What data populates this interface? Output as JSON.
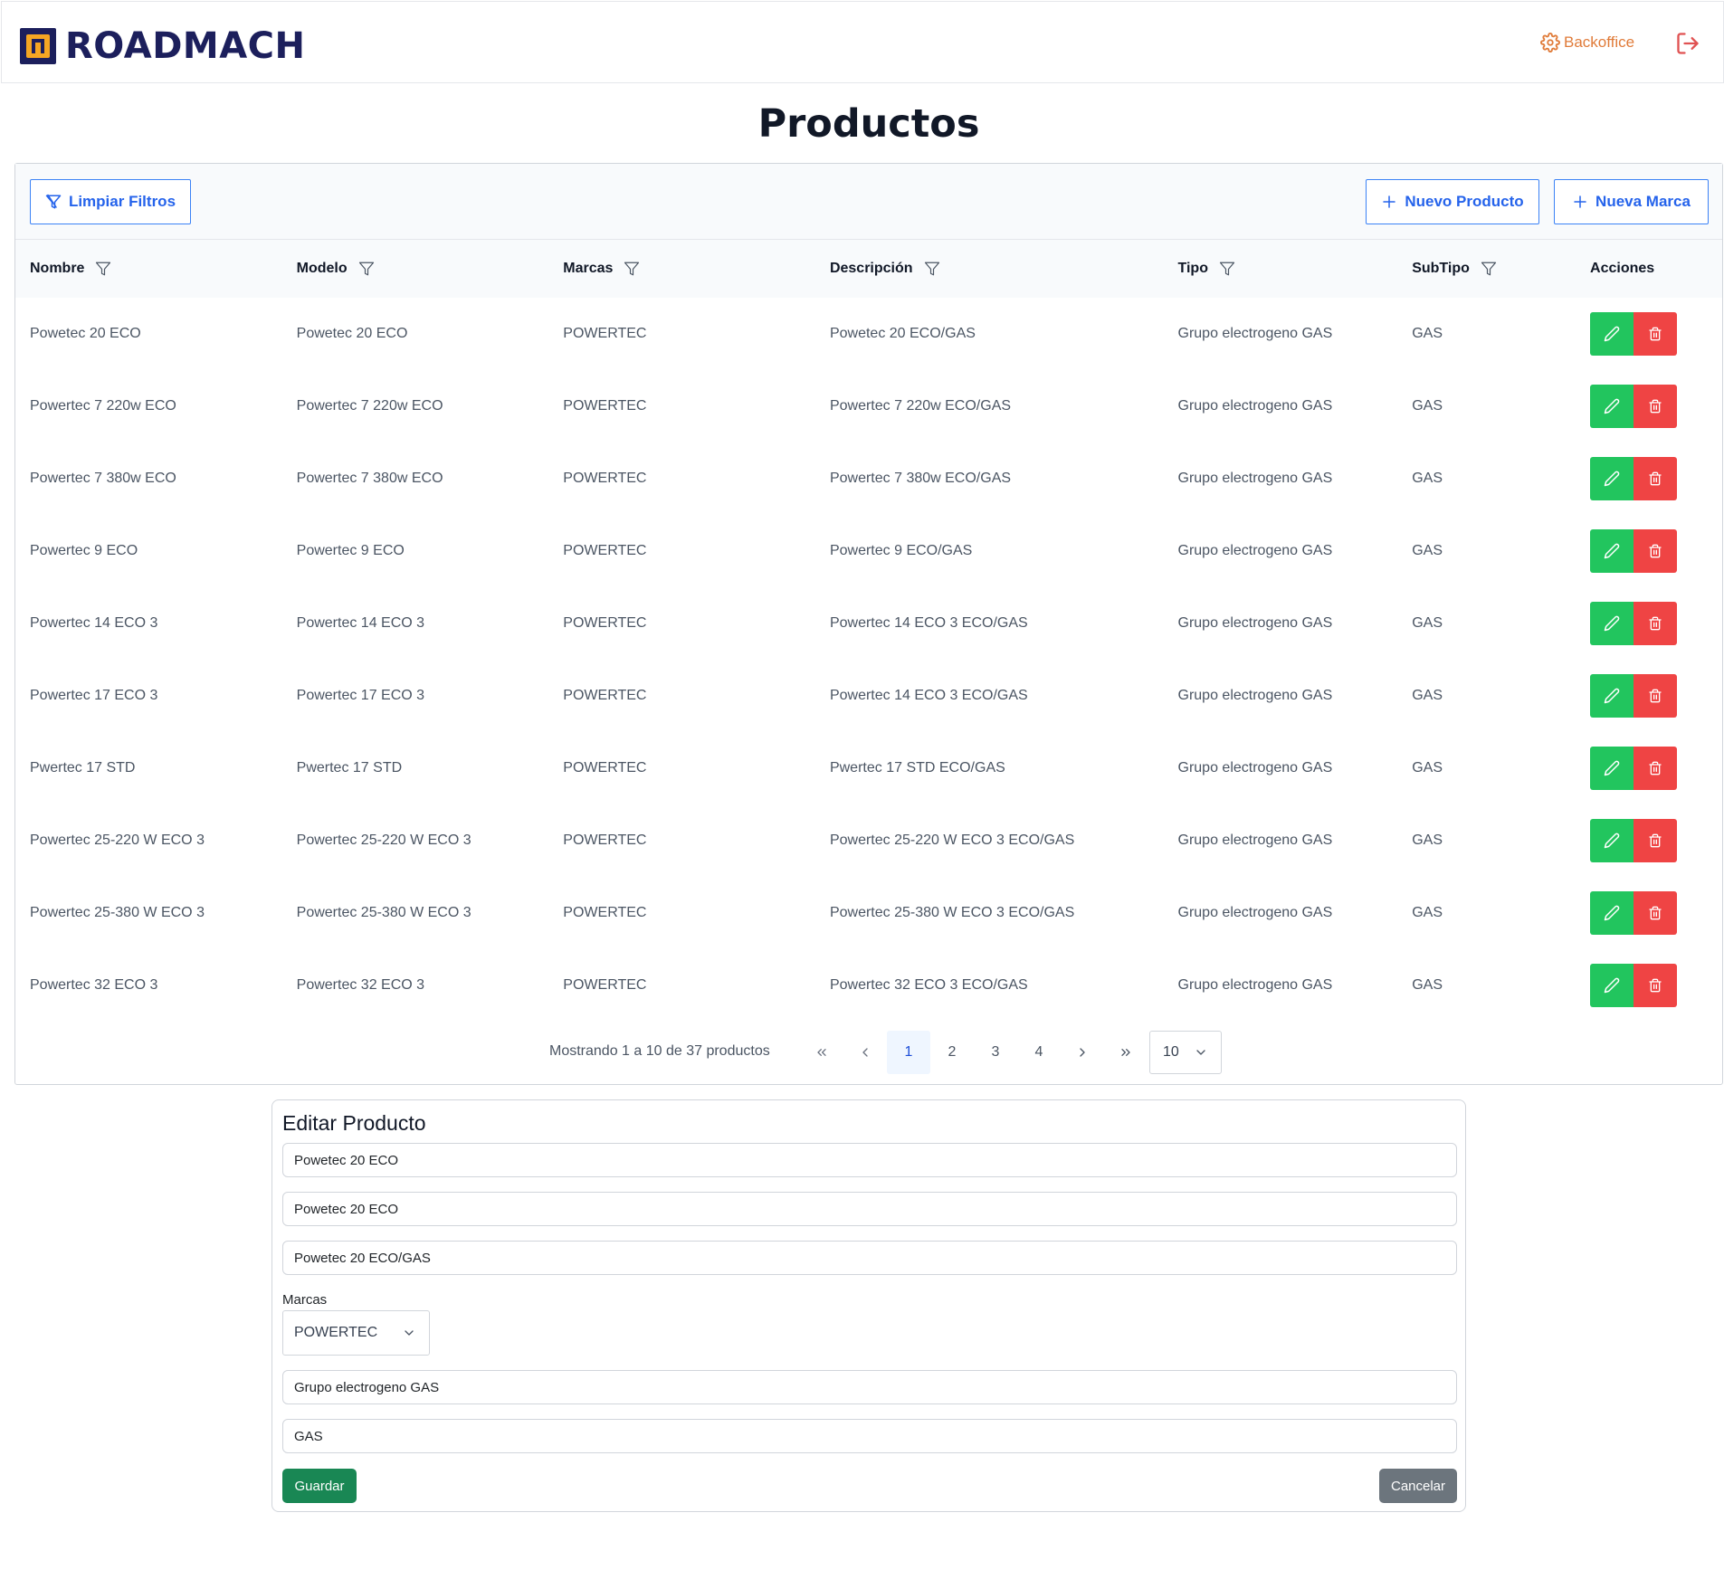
{
  "header": {
    "brand": "ROADMACH",
    "backoffice_label": "Backoffice",
    "colors": {
      "brand": "#1c1f5c",
      "accent": "#e07b39"
    }
  },
  "page_title": "Productos",
  "toolbar": {
    "clear_filters_label": "Limpiar Filtros",
    "new_product_label": "Nuevo Producto",
    "new_brand_label": "Nueva Marca"
  },
  "table": {
    "columns": [
      "Nombre",
      "Modelo",
      "Marcas",
      "Descripción",
      "Tipo",
      "SubTipo",
      "Acciones"
    ],
    "rows": [
      [
        "Powetec 20 ECO",
        "Powetec 20 ECO",
        "POWERTEC",
        "Powetec 20 ECO/GAS",
        "Grupo electrogeno GAS",
        "GAS"
      ],
      [
        "Powertec 7 220w ECO",
        "Powertec 7 220w ECO",
        "POWERTEC",
        "Powertec 7 220w ECO/GAS",
        "Grupo electrogeno GAS",
        "GAS"
      ],
      [
        "Powertec 7 380w ECO",
        "Powertec 7 380w ECO",
        "POWERTEC",
        "Powertec 7 380w ECO/GAS",
        "Grupo electrogeno GAS",
        "GAS"
      ],
      [
        "Powertec 9 ECO",
        "Powertec 9 ECO",
        "POWERTEC",
        "Powertec 9 ECO/GAS",
        "Grupo electrogeno GAS",
        "GAS"
      ],
      [
        "Powertec 14 ECO 3",
        "Powertec 14 ECO 3",
        "POWERTEC",
        "Powertec 14 ECO 3 ECO/GAS",
        "Grupo electrogeno GAS",
        "GAS"
      ],
      [
        "Powertec 17 ECO 3",
        "Powertec 17 ECO 3",
        "POWERTEC",
        "Powertec 14 ECO 3 ECO/GAS",
        "Grupo electrogeno GAS",
        "GAS"
      ],
      [
        "Pwertec 17 STD",
        "Pwertec 17 STD",
        "POWERTEC",
        "Pwertec 17 STD ECO/GAS",
        "Grupo electrogeno GAS",
        "GAS"
      ],
      [
        "Powertec 25-220 W ECO 3",
        "Powertec 25-220 W ECO 3",
        "POWERTEC",
        "Powertec 25-220 W ECO 3 ECO/GAS",
        "Grupo electrogeno GAS",
        "GAS"
      ],
      [
        "Powertec 25-380 W ECO 3",
        "Powertec 25-380 W ECO 3",
        "POWERTEC",
        "Powertec 25-380 W ECO 3 ECO/GAS",
        "Grupo electrogeno GAS",
        "GAS"
      ],
      [
        "Powertec 32 ECO 3",
        "Powertec 32 ECO 3",
        "POWERTEC",
        "Powertec 32 ECO 3 ECO/GAS",
        "Grupo electrogeno GAS",
        "GAS"
      ]
    ],
    "action_colors": {
      "edit": "#22c55e",
      "delete": "#ef4444"
    }
  },
  "paginator": {
    "info": "Mostrando 1 a 10 de 37 productos",
    "pages": [
      "1",
      "2",
      "3",
      "4"
    ],
    "current": "1",
    "rows_per_page": "10"
  },
  "edit_form": {
    "title": "Editar Producto",
    "nombre": "Powetec 20 ECO",
    "modelo": "Powetec 20 ECO",
    "descripcion": "Powetec 20 ECO/GAS",
    "marcas_label": "Marcas",
    "marca_selected": "POWERTEC",
    "tipo": "Grupo electrogeno GAS",
    "subtipo": "GAS",
    "save_label": "Guardar",
    "cancel_label": "Cancelar"
  }
}
